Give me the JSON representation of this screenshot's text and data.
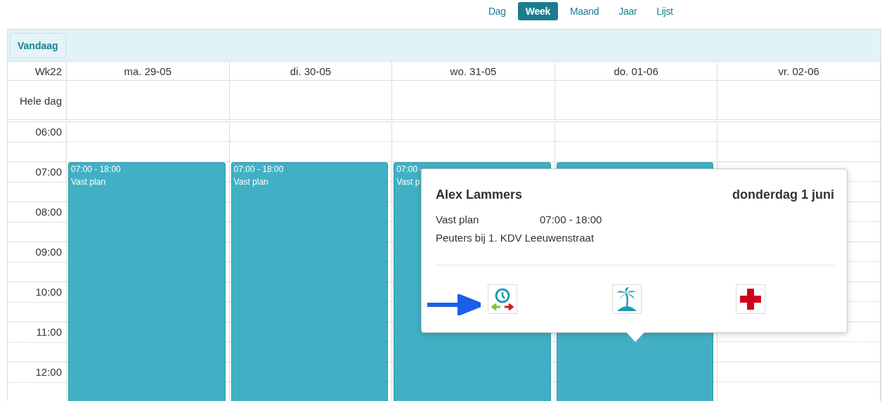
{
  "view_tabs": [
    {
      "label": "Dag",
      "selected": false
    },
    {
      "label": "Week",
      "selected": true
    },
    {
      "label": "Maand",
      "selected": false
    },
    {
      "label": "Jaar",
      "selected": false
    },
    {
      "label": "Lijst",
      "selected": false
    }
  ],
  "toolbar": {
    "today_button": "Vandaag"
  },
  "calendar": {
    "week_label": "Wk22",
    "all_day_label": "Hele dag",
    "days": [
      {
        "header": "ma. 29-05",
        "event": {
          "kind": "shift",
          "time": "07:00 - 18:00",
          "title": "Vast plan"
        }
      },
      {
        "header": "di. 30-05",
        "event": {
          "kind": "shift",
          "time": "07:00 - 18:00",
          "title": "Vast plan"
        }
      },
      {
        "header": "wo. 31-05",
        "event": {
          "kind": "shift",
          "time": "07:00 -",
          "title": "Vast p"
        }
      },
      {
        "header": "do. 01-06",
        "event": {
          "kind": "shift"
        }
      },
      {
        "header": "vr. 02-06"
      }
    ],
    "times": [
      "06:00",
      "07:00",
      "08:00",
      "09:00",
      "10:00",
      "11:00",
      "12:00"
    ]
  },
  "popup": {
    "name": "Alex Lammers",
    "date": "donderdag 1 juni",
    "plan": "Vast plan",
    "plan_time": "07:00 - 18:00",
    "location": "Peuters bij 1. KDV Leeuwenstraat",
    "actions": [
      {
        "kind": "clock-swap"
      },
      {
        "kind": "vacation"
      },
      {
        "kind": "sick"
      }
    ]
  }
}
